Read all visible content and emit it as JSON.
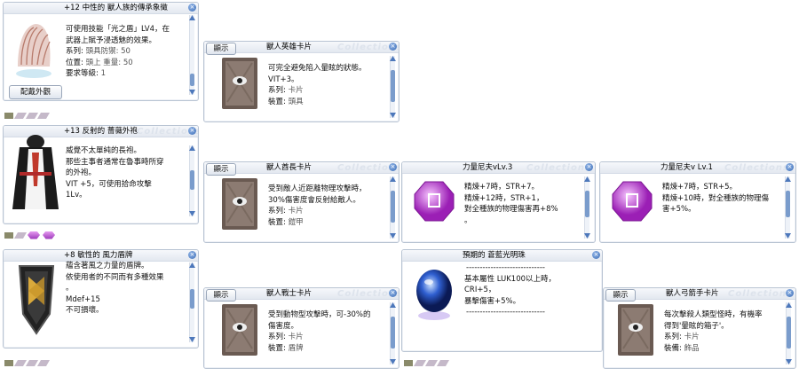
{
  "watermark": "Collections",
  "button_appearance": "配戴外觀",
  "button_show": "顯示",
  "items": {
    "headgear": {
      "title": "+12 中性的 獸人族的傳承象徵",
      "lines": [
        "可使用技能「光之盾」LV4，在",
        "武器上賦予浸透魅的效果。"
      ],
      "row1": [
        "系列: ",
        "頭具防禦: 50"
      ],
      "row2": [
        "位置: ",
        "頭上 重量: 50"
      ],
      "row3": [
        "要求等級: ",
        "1"
      ]
    },
    "garment": {
      "title": "+13 反射的 薔薇外袍",
      "lines": [
        "威覺不太單純的長袍。",
        "那些主事者通常在魯事時所穿",
        "的外袍。",
        "VIT +5，可使用拾命攻擊",
        "1Lv。"
      ]
    },
    "shield": {
      "title": "+8 敏性的 風力盾牌",
      "lines": [
        "蘊含著風之力量的盾牌。",
        "依使用者的不同而有多種效果",
        "。",
        "Mdef+15",
        "不可損壞。"
      ]
    },
    "orb": {
      "title": "預期的 蒼藍光明珠",
      "sep": "-----------------------------",
      "lines": [
        "基本屬性 LUK100以上時，",
        "CRI+5，",
        "暴擊傷害+5%。"
      ]
    },
    "card_hero": {
      "title": "獸人英雄卡片",
      "lines": [
        "可完全避免陷入暈眩的狀態。",
        "VIT+3。"
      ],
      "type_label": "系列: ",
      "type_value": "卡片",
      "equip_label": "裝置: ",
      "equip_value": "頭具"
    },
    "card_chief": {
      "title": "獸人酋長卡片",
      "lines": [
        "受到敵人近距離物理攻擊時，",
        "30%傷害度會反射給敵人。"
      ],
      "type_label": "系列: ",
      "type_value": "卡片",
      "equip_label": "裝置: ",
      "equip_value": "鎧甲"
    },
    "card_warrior": {
      "title": "獸人戰士卡片",
      "lines": [
        "受到動物型攻擊時，可-30%的",
        "傷害度。"
      ],
      "type_label": "系列: ",
      "type_value": "卡片",
      "equip_label": "裝置: ",
      "equip_value": "盾牌"
    },
    "card_archer": {
      "title": "獸人弓箭手卡片",
      "lines": [
        "每次擊殺人類型怪時，有機率",
        "得到'暈眩的箱子'。"
      ],
      "type_label": "系列: ",
      "type_value": "卡片",
      "equip_label": "裝備: ",
      "equip_value": "飾品"
    },
    "enchant_v3": {
      "title": "力量尼夫vLv.3",
      "lines": [
        "精煉+7時，STR+7。",
        "精煉+12時，STR+1，",
        "對全種族的物理傷害再+8%",
        "。"
      ]
    },
    "enchant_v1": {
      "title": "力量尼夫v Lv.1",
      "lines": [
        "精煉+7時，STR+5。",
        "精煉+10時，對全種族的物理傷",
        "害+5%。"
      ]
    }
  }
}
